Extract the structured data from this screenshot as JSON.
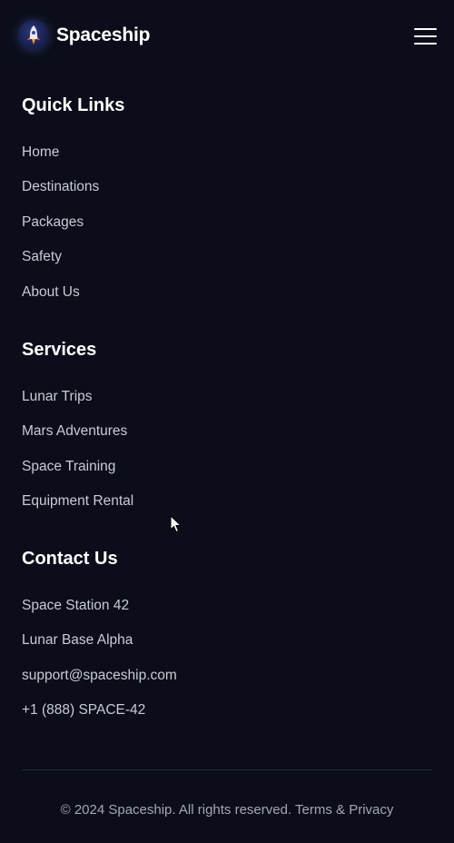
{
  "header": {
    "brand_name": "Spaceship",
    "logo_icon": "rocket-icon",
    "menu_icon": "hamburger-menu-icon"
  },
  "quick_links": {
    "title": "Quick Links",
    "items": [
      "Home",
      "Destinations",
      "Packages",
      "Safety",
      "About Us"
    ]
  },
  "services": {
    "title": "Services",
    "items": [
      "Lunar Trips",
      "Mars Adventures",
      "Space Training",
      "Equipment Rental"
    ]
  },
  "contact": {
    "title": "Contact Us",
    "items": [
      "Space Station 42",
      "Lunar Base Alpha",
      "support@spaceship.com",
      "+1 (888) SPACE-42"
    ]
  },
  "footer": {
    "copyright": "© 2024 Spaceship. All rights reserved.",
    "terms_link": "Terms & Privacy"
  },
  "colors": {
    "background": "#0b0e1a",
    "heading": "#ffffff",
    "link": "#c9cbd3",
    "footer_text": "#a4a7b3",
    "divider": "#252a3a"
  }
}
